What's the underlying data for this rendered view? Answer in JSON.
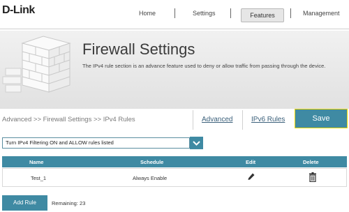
{
  "header": {
    "logo": "D-Link",
    "nav": {
      "home": "Home",
      "settings": "Settings",
      "features": "Features",
      "management": "Management"
    }
  },
  "banner": {
    "title": "Firewall Settings",
    "description": "The IPv4 rule section is an advance feature used to deny or allow traffic from passing through the device."
  },
  "breadcrumb": "Advanced >> Firewall Settings >> IPv4 Rules",
  "links": {
    "advanced": "Advanced",
    "ipv6_rules": "IPv6 Rules",
    "save": "Save"
  },
  "filter_select": {
    "selected": "Turn IPv4 Filtering ON and ALLOW rules listed"
  },
  "table": {
    "headers": [
      "Name",
      "Schedule",
      "Edit",
      "Delete"
    ],
    "rows": [
      {
        "name": "Test_1",
        "schedule": "Always Enable"
      }
    ]
  },
  "footer": {
    "add_rule": "Add Rule",
    "remaining": "Remaining: 23"
  },
  "colors": {
    "accent": "#3f8aa3",
    "save_border": "#f0d800"
  }
}
